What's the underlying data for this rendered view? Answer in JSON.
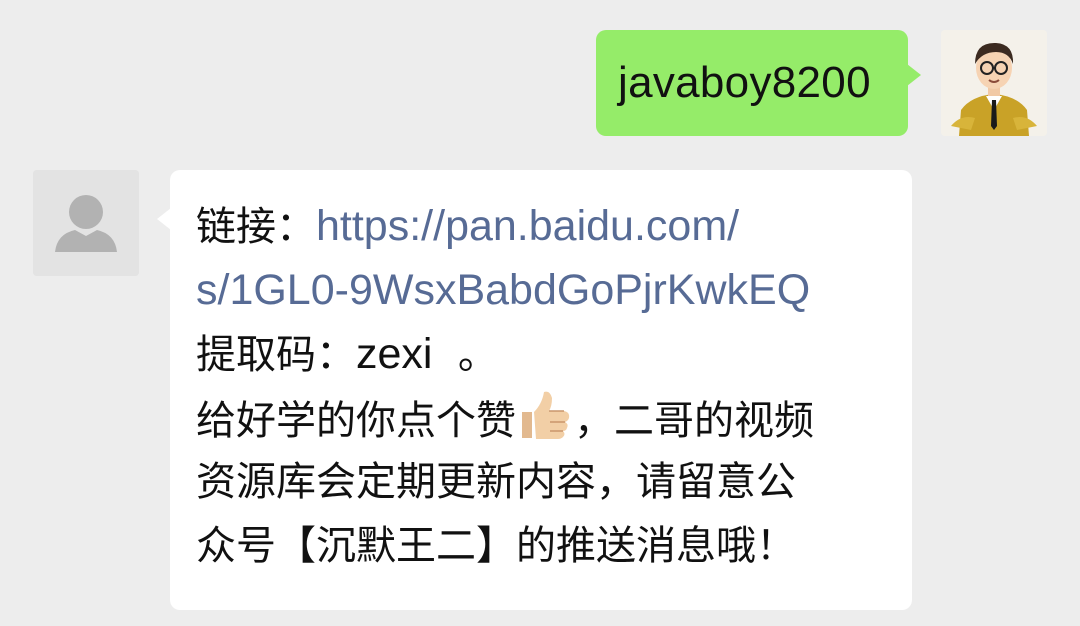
{
  "sent_message": {
    "text": "javaboy8200"
  },
  "received_message": {
    "link_prefix": "链接：",
    "link_line1": "https://pan.baidu.com/",
    "link_line2": "s/1GL0-9WsxBabdGoPjrKwkEQ",
    "code_label": "提取码：",
    "code_value": "zexi",
    "code_suffix": "  。",
    "line4_part1": "给好学的你点个赞",
    "line4_emoji": "thumbs-up-icon",
    "line4_part2": "，二哥的视频",
    "line5": "资源库会定期更新内容，请留意公",
    "line6": "众号【沉默王二】的推送消息哦！"
  },
  "colors": {
    "background": "#ededed",
    "sent_bubble": "#95ec69",
    "received_bubble": "#ffffff",
    "link": "#576b95"
  }
}
